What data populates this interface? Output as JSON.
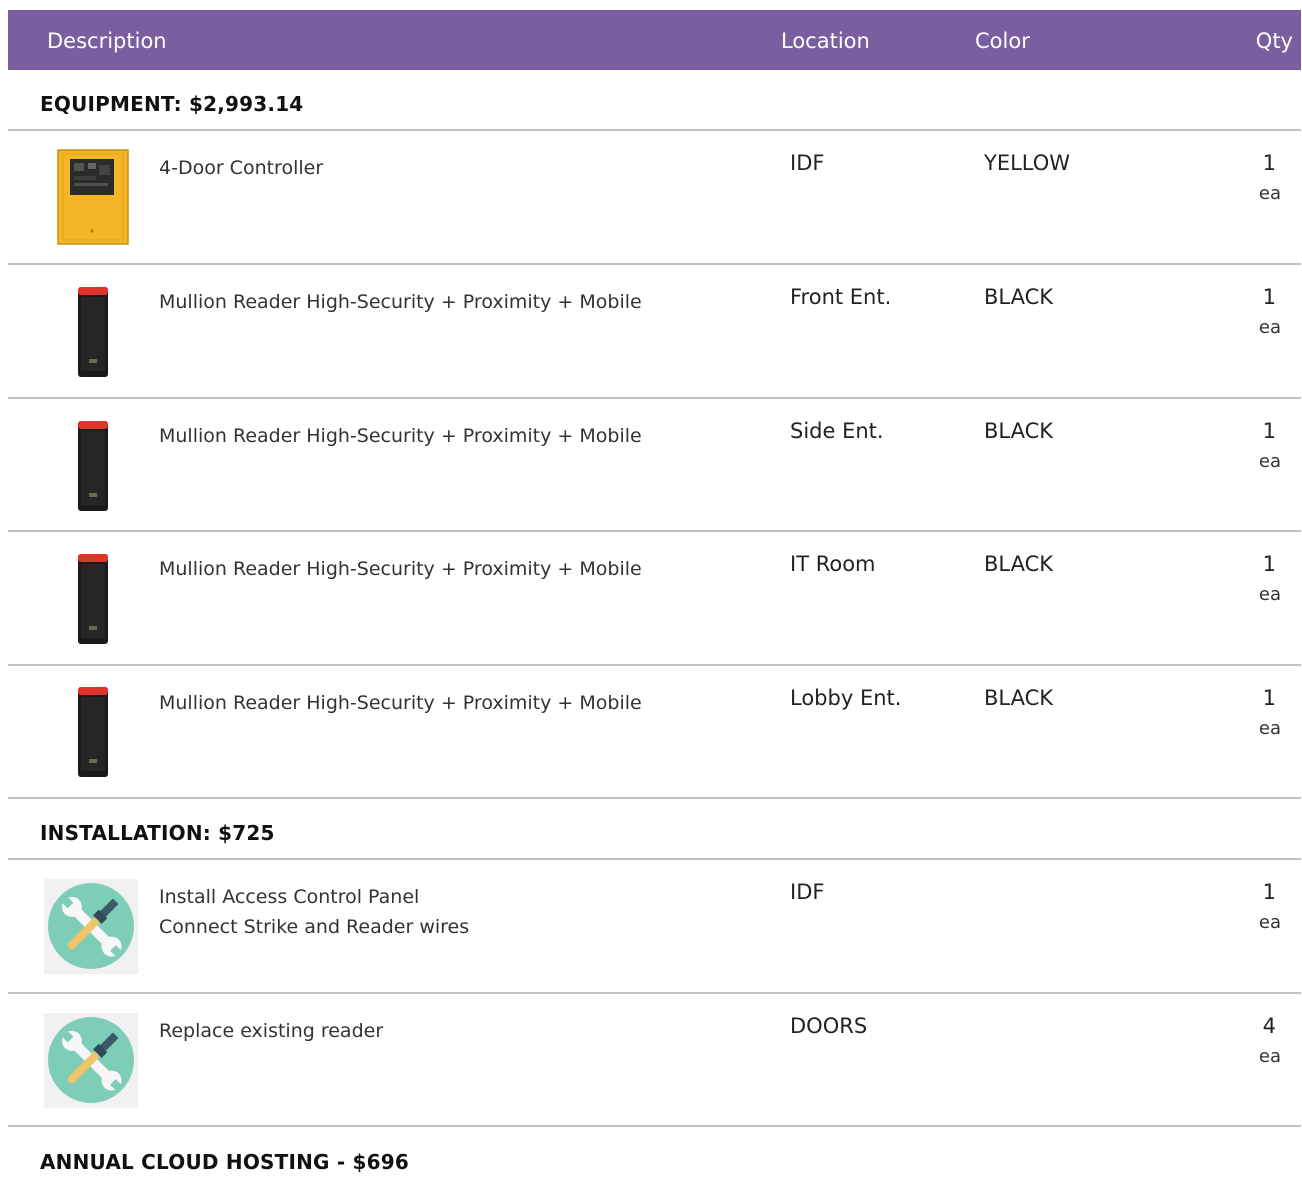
{
  "header": {
    "description": "Description",
    "location": "Location",
    "color": "Color",
    "qty": "Qty"
  },
  "sections": {
    "equipment": "EQUIPMENT: $2,993.14",
    "installation": "INSTALLATION: $725",
    "hosting": "ANNUAL CLOUD HOSTING - $696"
  },
  "equipment_rows": [
    {
      "image": "controller-panel-image",
      "description": "4-Door Controller",
      "location": "IDF",
      "color": "YELLOW",
      "qty": "1",
      "unit": "ea"
    },
    {
      "image": "reader-image",
      "description": "Mullion Reader High-Security + Proximity + Mobile",
      "location": "Front Ent.",
      "color": "BLACK",
      "qty": "1",
      "unit": "ea"
    },
    {
      "image": "reader-image",
      "description": "Mullion Reader High-Security + Proximity + Mobile",
      "location": "Side Ent.",
      "color": "BLACK",
      "qty": "1",
      "unit": "ea"
    },
    {
      "image": "reader-image",
      "description": "Mullion Reader High-Security + Proximity + Mobile",
      "location": "IT Room",
      "color": "BLACK",
      "qty": "1",
      "unit": "ea"
    },
    {
      "image": "reader-image",
      "description": "Mullion Reader High-Security + Proximity + Mobile",
      "location": "Lobby Ent.",
      "color": "BLACK",
      "qty": "1",
      "unit": "ea"
    }
  ],
  "installation_rows": [
    {
      "image": "tools-icon",
      "description_lines": [
        "Install Access Control Panel",
        "Connect Strike and Reader wires"
      ],
      "location": "IDF",
      "color": "",
      "qty": "1",
      "unit": "ea"
    },
    {
      "image": "tools-icon",
      "description_lines": [
        "Replace existing reader"
      ],
      "location": "DOORS",
      "color": "",
      "qty": "4",
      "unit": "ea"
    }
  ],
  "colors": {
    "header_bg": "#7b5ea0",
    "tools_circle": "#7ecdb8",
    "controller_yellow": "#f4b626",
    "reader_red": "#e0352b"
  }
}
